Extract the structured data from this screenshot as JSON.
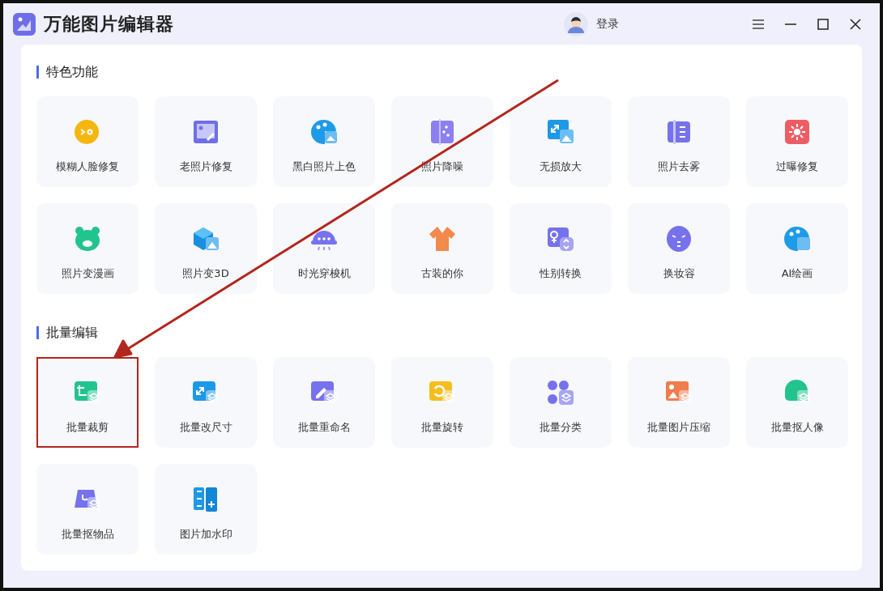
{
  "window": {
    "title": "万能图片编辑器",
    "user": {
      "label": "登录"
    }
  },
  "sections": [
    {
      "title": "特色功能",
      "items": [
        {
          "label": "模糊人脸修复",
          "kind": "face",
          "highlighted": false
        },
        {
          "label": "老照片修复",
          "kind": "photo-wrench",
          "highlighted": false
        },
        {
          "label": "黑白照片上色",
          "kind": "palette",
          "highlighted": false
        },
        {
          "label": "照片降噪",
          "kind": "dots-panel",
          "highlighted": false
        },
        {
          "label": "无损放大",
          "kind": "expand",
          "highlighted": false
        },
        {
          "label": "照片去雾",
          "kind": "book",
          "highlighted": false
        },
        {
          "label": "过曝修复",
          "kind": "sun",
          "highlighted": false
        },
        {
          "label": "照片变漫画",
          "kind": "bear",
          "highlighted": false
        },
        {
          "label": "照片变3D",
          "kind": "cube",
          "highlighted": false
        },
        {
          "label": "时光穿梭机",
          "kind": "ufo",
          "highlighted": false
        },
        {
          "label": "古装的你",
          "kind": "robe",
          "highlighted": false
        },
        {
          "label": "性别转换",
          "kind": "gender",
          "highlighted": false
        },
        {
          "label": "换妆容",
          "kind": "mask",
          "highlighted": false
        },
        {
          "label": "AI绘画",
          "kind": "palette-ai",
          "highlighted": false
        }
      ]
    },
    {
      "title": "批量编辑",
      "items": [
        {
          "label": "批量裁剪",
          "kind": "crop",
          "highlighted": true
        },
        {
          "label": "批量改尺寸",
          "kind": "resize",
          "highlighted": false
        },
        {
          "label": "批量重命名",
          "kind": "rename",
          "highlighted": false
        },
        {
          "label": "批量旋转",
          "kind": "rotate",
          "highlighted": false
        },
        {
          "label": "批量分类",
          "kind": "classify",
          "highlighted": false
        },
        {
          "label": "批量图片压缩",
          "kind": "compress",
          "highlighted": false
        },
        {
          "label": "批量抠人像",
          "kind": "portrait",
          "highlighted": false
        },
        {
          "label": "批量抠物品",
          "kind": "object",
          "highlighted": false
        },
        {
          "label": "图片加水印",
          "kind": "watermark",
          "highlighted": false
        }
      ]
    }
  ]
}
